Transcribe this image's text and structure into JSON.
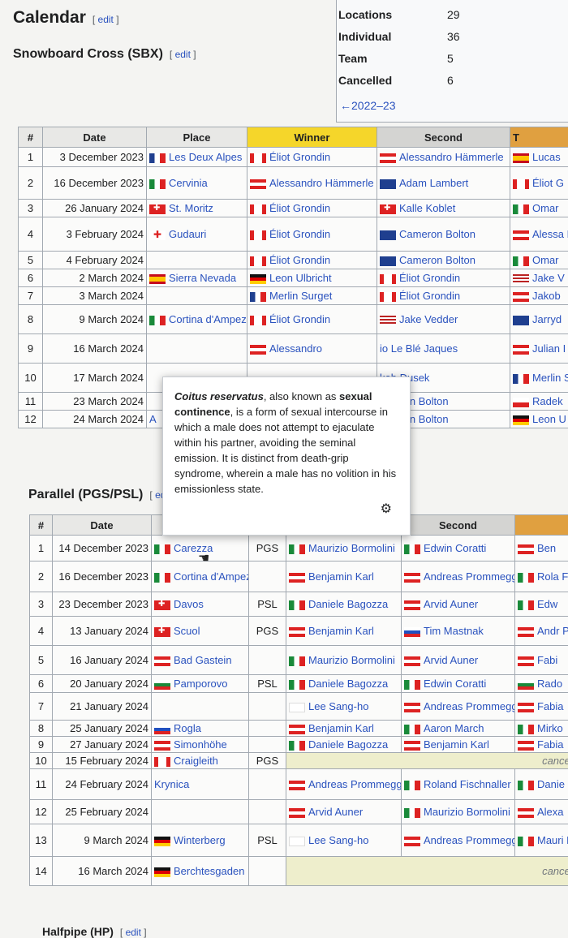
{
  "headings": {
    "calendar": "Calendar",
    "sbx": "Snowboard Cross (SBX)",
    "parallel": "Parallel (PGS/PSL)",
    "halfpipe": "Halfpipe (HP)",
    "edit": "edit"
  },
  "summary": {
    "rows": [
      {
        "label": "Locations",
        "value": "29"
      },
      {
        "label": "Individual",
        "value": "36"
      },
      {
        "label": "Team",
        "value": "5"
      },
      {
        "label": "Cancelled",
        "value": "6"
      }
    ],
    "prev_season": "←2022–23"
  },
  "sbx_table": {
    "headers": [
      "#",
      "Date",
      "Place",
      "Winner",
      "Second",
      "T"
    ],
    "header_colors": {
      "winner": "#f5d62a",
      "third": "#e0a040"
    },
    "rows": [
      {
        "n": "1",
        "date": "3 December 2023",
        "place": "Les Deux Alpes",
        "pf": "fr",
        "w": "Éliot Grondin",
        "wf": "ca",
        "s": "Alessandro Hämmerle",
        "sf": "at",
        "t": "Lucas",
        "tf": "es"
      },
      {
        "n": "2",
        "date": "16 December 2023",
        "place": "Cervinia",
        "pf": "it",
        "w": "Alessandro Hämmerle",
        "wf": "at",
        "s": "Adam Lambert",
        "sf": "au",
        "t": "Éliot G",
        "tf": "ca"
      },
      {
        "n": "3",
        "date": "26 January 2024",
        "place": "St. Moritz",
        "pf": "ch",
        "w": "Éliot Grondin",
        "wf": "ca",
        "s": "Kalle Koblet",
        "sf": "ch",
        "t": "Omar",
        "tf": "it"
      },
      {
        "n": "4",
        "date": "3 February 2024",
        "place": "Gudauri",
        "pf": "ge",
        "w": "Éliot Grondin",
        "wf": "ca",
        "s": "Cameron Bolton",
        "sf": "au",
        "t": "Alessa Hämmerle",
        "tf": "at"
      },
      {
        "n": "5",
        "date": "4 February 2024",
        "place": "",
        "pf": "",
        "w": "Éliot Grondin",
        "wf": "ca",
        "s": "Cameron Bolton",
        "sf": "au",
        "t": "Omar",
        "tf": "it"
      },
      {
        "n": "6",
        "date": "2 March 2024",
        "place": "Sierra Nevada",
        "pf": "es",
        "w": "Leon Ulbricht",
        "wf": "de",
        "s": "Éliot Grondin",
        "sf": "ca",
        "t": "Jake V",
        "tf": "us"
      },
      {
        "n": "7",
        "date": "3 March 2024",
        "place": "",
        "pf": "",
        "w": "Merlin Surget",
        "wf": "fr",
        "s": "Éliot Grondin",
        "sf": "ca",
        "t": "Jakob",
        "tf": "at"
      },
      {
        "n": "8",
        "date": "9 March 2024",
        "place": "Cortina d'Ampezzo",
        "pf": "it",
        "w": "Éliot Grondin",
        "wf": "ca",
        "s": "Jake Vedder",
        "sf": "us",
        "t": "Jarryd",
        "tf": "au"
      },
      {
        "n": "9",
        "date": "16 March 2024",
        "place": "",
        "pf": "",
        "w": "Alessandro",
        "wf": "at",
        "s": "io Le Blé Jaques",
        "sf": "",
        "t": "Julian I",
        "tf": "at"
      },
      {
        "n": "10",
        "date": "17 March 2024",
        "place": "",
        "pf": "",
        "w": "",
        "wf": "",
        "s": "kob Dusek",
        "sf": "",
        "t": "Merlin S",
        "tf": "fr"
      },
      {
        "n": "11",
        "date": "23 March 2024",
        "place": "",
        "pf": "",
        "w": "",
        "wf": "",
        "s": "ameron Bolton",
        "sf": "",
        "t": "Radek",
        "tf": "cz"
      },
      {
        "n": "12",
        "date": "24 March 2024",
        "place": "A",
        "pf": "",
        "w": "",
        "wf": "",
        "s": "ameron Bolton",
        "sf": "",
        "t": "Leon U",
        "tf": "de"
      }
    ]
  },
  "parallel_table": {
    "headers": [
      "#",
      "Date",
      "",
      "",
      "",
      "Second",
      ""
    ],
    "rows": [
      {
        "n": "1",
        "date": "14 December 2023",
        "place": "Carezza",
        "pf": "it",
        "fmt": "PGS",
        "w": "Maurizio Bormolini",
        "wf": "it",
        "s": "Edwin Coratti",
        "sf": "it",
        "t": "Ben",
        "tf": "at"
      },
      {
        "n": "2",
        "date": "16 December 2023",
        "place": "Cortina d'Ampezzo",
        "pf": "it",
        "fmt": "",
        "w": "Benjamin Karl",
        "wf": "at",
        "s": "Andreas Prommegger",
        "sf": "at",
        "t": "Rola Fischnall",
        "tf": "it"
      },
      {
        "n": "3",
        "date": "23 December 2023",
        "place": "Davos",
        "pf": "ch",
        "fmt": "PSL",
        "w": "Daniele Bagozza",
        "wf": "it",
        "s": "Arvid Auner",
        "sf": "at",
        "t": "Edw",
        "tf": "it"
      },
      {
        "n": "4",
        "date": "13 January 2024",
        "place": "Scuol",
        "pf": "ch",
        "fmt": "PGS",
        "w": "Benjamin Karl",
        "wf": "at",
        "s": "Tim Mastnak",
        "sf": "si",
        "t": "Andr Promme",
        "tf": "at"
      },
      {
        "n": "5",
        "date": "16 January 2024",
        "place": "Bad Gastein",
        "pf": "at",
        "fmt": "",
        "w": "Maurizio Bormolini",
        "wf": "it",
        "s": "Arvid Auner",
        "sf": "at",
        "t": "Fabi",
        "tf": "at"
      },
      {
        "n": "6",
        "date": "20 January 2024",
        "place": "Pamporovo",
        "pf": "bg",
        "fmt": "PSL",
        "w": "Daniele Bagozza",
        "wf": "it",
        "s": "Edwin Coratti",
        "sf": "it",
        "t": "Rado",
        "tf": "bg"
      },
      {
        "n": "7",
        "date": "21 January 2024",
        "place": "",
        "pf": "",
        "fmt": "",
        "w": "Lee Sang-ho",
        "wf": "kr",
        "s": "Andreas Prommegger",
        "sf": "at",
        "t": "Fabia",
        "tf": "at"
      },
      {
        "n": "8",
        "date": "25 January 2024",
        "place": "Rogla",
        "pf": "si",
        "fmt": "",
        "w": "Benjamin Karl",
        "wf": "at",
        "s": "Aaron March",
        "sf": "it",
        "t": "Mirko",
        "tf": "it"
      },
      {
        "n": "9",
        "date": "27 January 2024",
        "place": "Simonhöhe",
        "pf": "at",
        "fmt": "",
        "w": "Daniele Bagozza",
        "wf": "it",
        "s": "Benjamin Karl",
        "sf": "at",
        "t": "Fabia",
        "tf": "at"
      },
      {
        "n": "10",
        "date": "15 February 2024",
        "place": "Craigleith",
        "pf": "ca",
        "fmt": "PGS",
        "cancelled": "cancelled"
      },
      {
        "n": "11",
        "date": "24 February 2024",
        "place": "Krynica",
        "pf": "",
        "fmt": "",
        "w": "Andreas Prommegger",
        "wf": "at",
        "s": "Roland Fischnaller",
        "sf": "it",
        "t": "Danie",
        "tf": "it"
      },
      {
        "n": "12",
        "date": "25 February 2024",
        "place": "",
        "pf": "",
        "fmt": "",
        "w": "Arvid Auner",
        "wf": "at",
        "s": "Maurizio Bormolini",
        "sf": "it",
        "t": "Alexa",
        "tf": "at"
      },
      {
        "n": "13",
        "date": "9 March 2024",
        "place": "Winterberg",
        "pf": "de",
        "fmt": "PSL",
        "w": "Lee Sang-ho",
        "wf": "kr",
        "s": "Andreas Prommegger",
        "sf": "at",
        "t": "Mauri Bormolini",
        "tf": "it"
      },
      {
        "n": "14",
        "date": "16 March 2024",
        "place": "Berchtesgaden",
        "pf": "de",
        "fmt": "",
        "cancelled": "cancelled"
      }
    ]
  },
  "popup": {
    "term": "Coitus reservatus",
    "mid1": ", also known as ",
    "term2": "sexual continence",
    "body": ", is a form of sexual intercourse in which a male does not attempt to ejaculate within his partner, avoiding the seminal emission. It is distinct from death-grip syndrome, wherein a male has no volition in his emissionless state."
  }
}
